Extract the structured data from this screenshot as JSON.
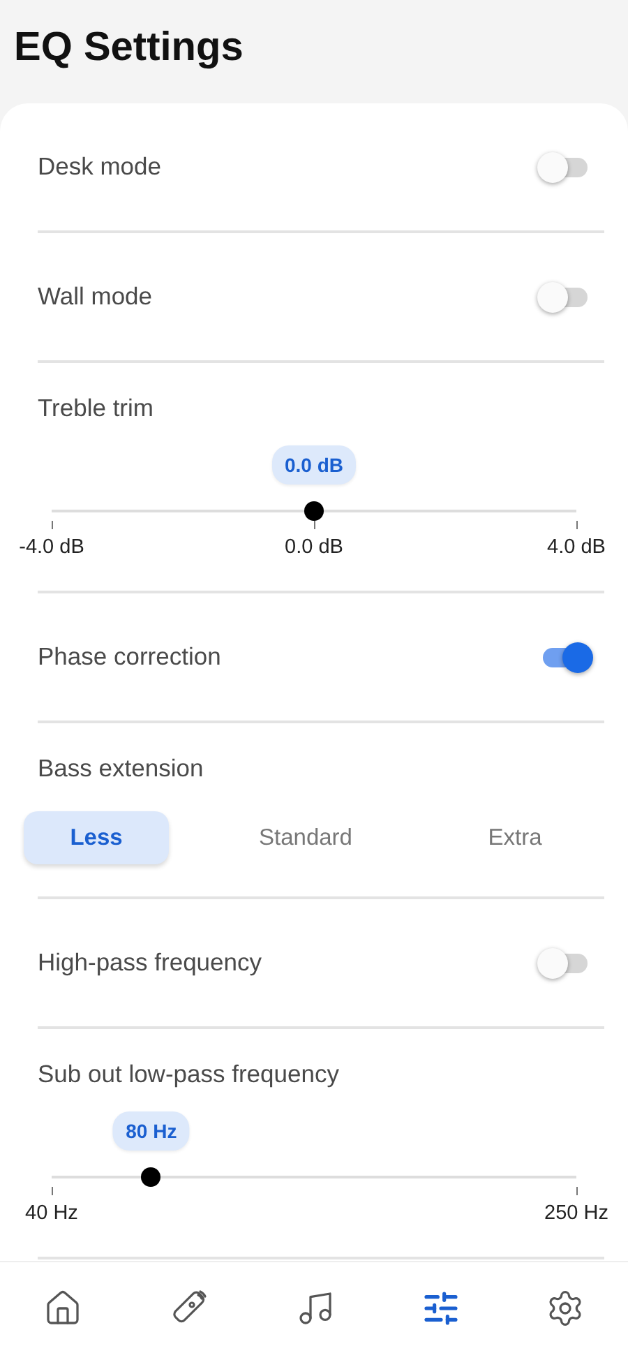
{
  "title": "EQ Settings",
  "settings": [
    {
      "kind": "toggle",
      "label": "Desk mode",
      "on": false
    },
    {
      "kind": "toggle",
      "label": "Wall mode",
      "on": false
    },
    {
      "kind": "slider",
      "label": "Treble trim",
      "value": "0.0 dB",
      "level": 0.5,
      "ticks": [
        "-4.0 dB",
        "0.0 dB",
        "4.0 dB"
      ]
    },
    {
      "kind": "toggle",
      "label": "Phase correction",
      "on": true
    },
    {
      "kind": "segmented",
      "label": "Bass extension",
      "options": [
        {
          "label": "Less",
          "selected": true
        },
        {
          "label": "Standard",
          "selected": false
        },
        {
          "label": "Extra",
          "selected": false
        }
      ]
    },
    {
      "kind": "toggle",
      "label": "High-pass frequency",
      "on": false
    },
    {
      "kind": "slider",
      "label": "Sub out low-pass frequency",
      "value": "80 Hz",
      "level": 0.19,
      "ticks": [
        "40 Hz",
        "250 Hz"
      ]
    }
  ],
  "nav": [
    {
      "kind": "home",
      "selected": false
    },
    {
      "kind": "remote",
      "selected": false
    },
    {
      "kind": "music",
      "selected": false
    },
    {
      "kind": "eq",
      "selected": true
    },
    {
      "kind": "settings",
      "selected": false
    }
  ]
}
